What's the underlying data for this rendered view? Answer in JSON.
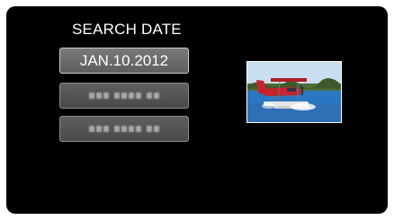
{
  "screen": {
    "title": "SEARCH DATE",
    "dates": [
      {
        "label": "JAN.10.2012",
        "selected": true
      },
      {
        "label": "",
        "selected": false,
        "redacted": true
      },
      {
        "label": "",
        "selected": false,
        "redacted": true
      }
    ]
  },
  "thumbnail": {
    "icon": "seaplane-photo"
  },
  "colors": {
    "background": "#000000",
    "button_selected": "#6b6b6b",
    "button_border": "#c9c9c9",
    "text": "#ffffff"
  }
}
